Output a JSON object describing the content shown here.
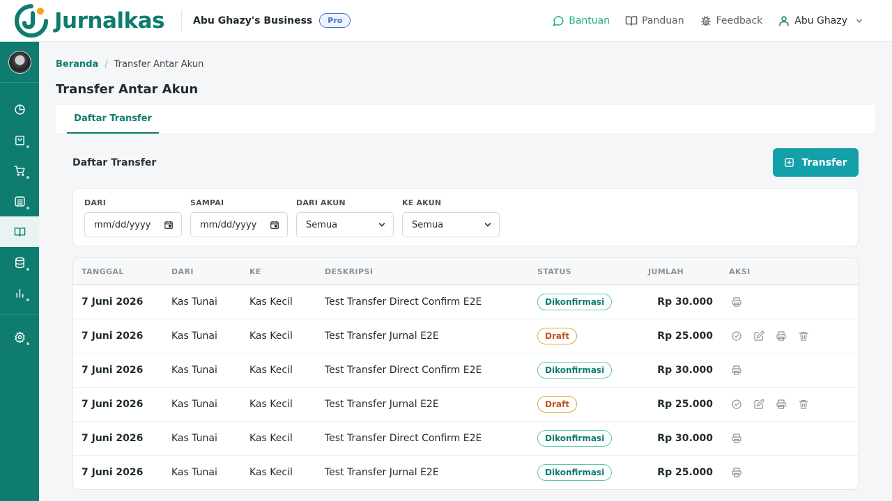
{
  "app": {
    "name": "Jurnalkas",
    "business": "Abu Ghazy's Business",
    "plan": "Pro"
  },
  "topnav": {
    "help": "Bantuan",
    "guide": "Panduan",
    "feedback": "Feedback",
    "user": "Abu Ghazy"
  },
  "sidebar": {
    "items": [
      {
        "icon": "dashboard-icon"
      },
      {
        "icon": "shopping-bag-icon"
      },
      {
        "icon": "cart-icon"
      },
      {
        "icon": "bank-icon"
      },
      {
        "icon": "book-icon",
        "active": true
      },
      {
        "icon": "database-icon"
      },
      {
        "icon": "chart-icon"
      },
      {
        "icon": "settings-icon"
      }
    ]
  },
  "breadcrumb": {
    "home": "Beranda",
    "current": "Transfer Antar Akun"
  },
  "page": {
    "title": "Transfer Antar Akun"
  },
  "tabs": [
    {
      "label": "Daftar Transfer"
    }
  ],
  "section": {
    "title": "Daftar Transfer",
    "button": "Transfer"
  },
  "filters": {
    "from_date": {
      "label": "DARI",
      "value": "mm/dd/yyyy"
    },
    "to_date": {
      "label": "SAMPAI",
      "value": "mm/dd/yyyy"
    },
    "from_account": {
      "label": "DARI AKUN",
      "value": "Semua"
    },
    "to_account": {
      "label": "KE AKUN",
      "value": "Semua"
    }
  },
  "table": {
    "headers": [
      "TANGGAL",
      "DARI",
      "KE",
      "DESKRIPSI",
      "STATUS",
      "JUMLAH",
      "AKSI"
    ],
    "rows": [
      {
        "date": "7 Juni 2026",
        "from": "Kas Tunai",
        "to": "Kas Kecil",
        "desc": "Test Transfer Direct Confirm E2E",
        "status": "Dikonfirmasi",
        "amount": "Rp 30.000"
      },
      {
        "date": "7 Juni 2026",
        "from": "Kas Tunai",
        "to": "Kas Kecil",
        "desc": "Test Transfer Jurnal E2E",
        "status": "Draft",
        "amount": "Rp 25.000"
      },
      {
        "date": "7 Juni 2026",
        "from": "Kas Tunai",
        "to": "Kas Kecil",
        "desc": "Test Transfer Direct Confirm E2E",
        "status": "Dikonfirmasi",
        "amount": "Rp 30.000"
      },
      {
        "date": "7 Juni 2026",
        "from": "Kas Tunai",
        "to": "Kas Kecil",
        "desc": "Test Transfer Jurnal E2E",
        "status": "Draft",
        "amount": "Rp 25.000"
      },
      {
        "date": "7 Juni 2026",
        "from": "Kas Tunai",
        "to": "Kas Kecil",
        "desc": "Test Transfer Direct Confirm E2E",
        "status": "Dikonfirmasi",
        "amount": "Rp 30.000"
      },
      {
        "date": "7 Juni 2026",
        "from": "Kas Tunai",
        "to": "Kas Kecil",
        "desc": "Test Transfer Jurnal E2E",
        "status": "Dikonfirmasi",
        "amount": "Rp 25.000"
      }
    ]
  },
  "colors": {
    "brand": "#0e7c6e",
    "accent": "#13a0a8",
    "help": "#22b573",
    "pro": "#3b6fd6",
    "draft": "#e8a23a"
  }
}
